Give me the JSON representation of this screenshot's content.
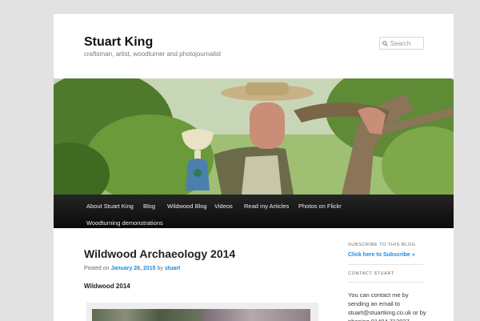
{
  "site": {
    "title": "Stuart King",
    "description": "craftsman, artist, woodturner and photojournalist"
  },
  "search": {
    "placeholder": "Search",
    "icon": "search-icon"
  },
  "nav": {
    "items": [
      {
        "label": "About Stuart King"
      },
      {
        "label": "Blog"
      },
      {
        "label": "Wildwood Blog"
      },
      {
        "label": "Videos"
      },
      {
        "label": "Read my Articles"
      },
      {
        "label": "Photos on Flickr"
      },
      {
        "label": "Woodturning demonstrations"
      }
    ]
  },
  "post": {
    "title": "Wildwood Archaeology 2014",
    "posted_on": "Posted on",
    "date": "January 26, 2015",
    "by": "by",
    "author": "stuart",
    "subheading": "Wildwood 2014"
  },
  "sidebar": {
    "subscribe": {
      "title": "Subscribe to this blog",
      "link": "Click here to Subscribe »"
    },
    "contact": {
      "title": "Contact Stuart",
      "text": "You can contact me by sending an email to stuart@stuartking.co.uk or by phoning 01494 712027."
    }
  },
  "colors": {
    "accent": "#1b8be0",
    "nav_bg": "#0a0a0a",
    "page_bg": "#e2e2e2"
  }
}
